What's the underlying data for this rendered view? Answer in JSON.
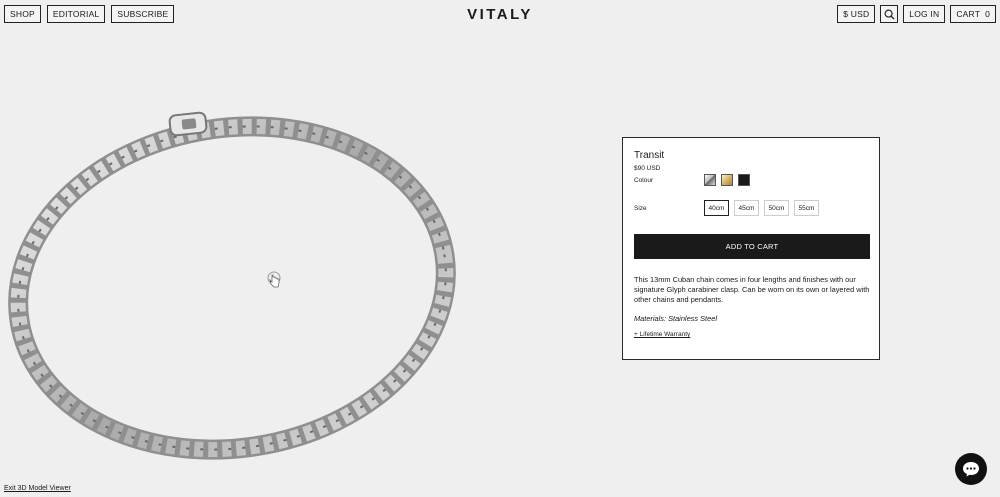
{
  "header": {
    "nav_left": [
      "SHOP",
      "EDITORIAL",
      "SUBSCRIBE"
    ],
    "logo": "VITALY",
    "currency": "$ USD",
    "login": "LOG IN",
    "cart": "CART  0"
  },
  "product": {
    "name": "Transit",
    "price": "$90 USD",
    "colour_label": "Colour",
    "swatches": [
      {
        "name": "silver",
        "color": "#c8c8c8"
      },
      {
        "name": "gold",
        "color": "#d4b366"
      },
      {
        "name": "black",
        "color": "#1a1a1a"
      }
    ],
    "size_label": "Size",
    "sizes": [
      "40cm",
      "45cm",
      "50cm",
      "55cm"
    ],
    "selected_size": "40cm",
    "add_to_cart": "ADD TO CART",
    "description": "This 13mm Cuban chain comes in four lengths and finishes with our signature Glyph carabiner clasp. Can be worn on its own or layered with other chains and pendants.",
    "materials": "Materials: Stainless Steel",
    "warranty": "+ Lifetime Warranty"
  },
  "viewer": {
    "exit_label": "Exit 3D Model Viewer"
  },
  "colors": {
    "background": "#efefef",
    "button_dark": "#1a1a1a",
    "chain_silver": "#b9b9b9"
  }
}
